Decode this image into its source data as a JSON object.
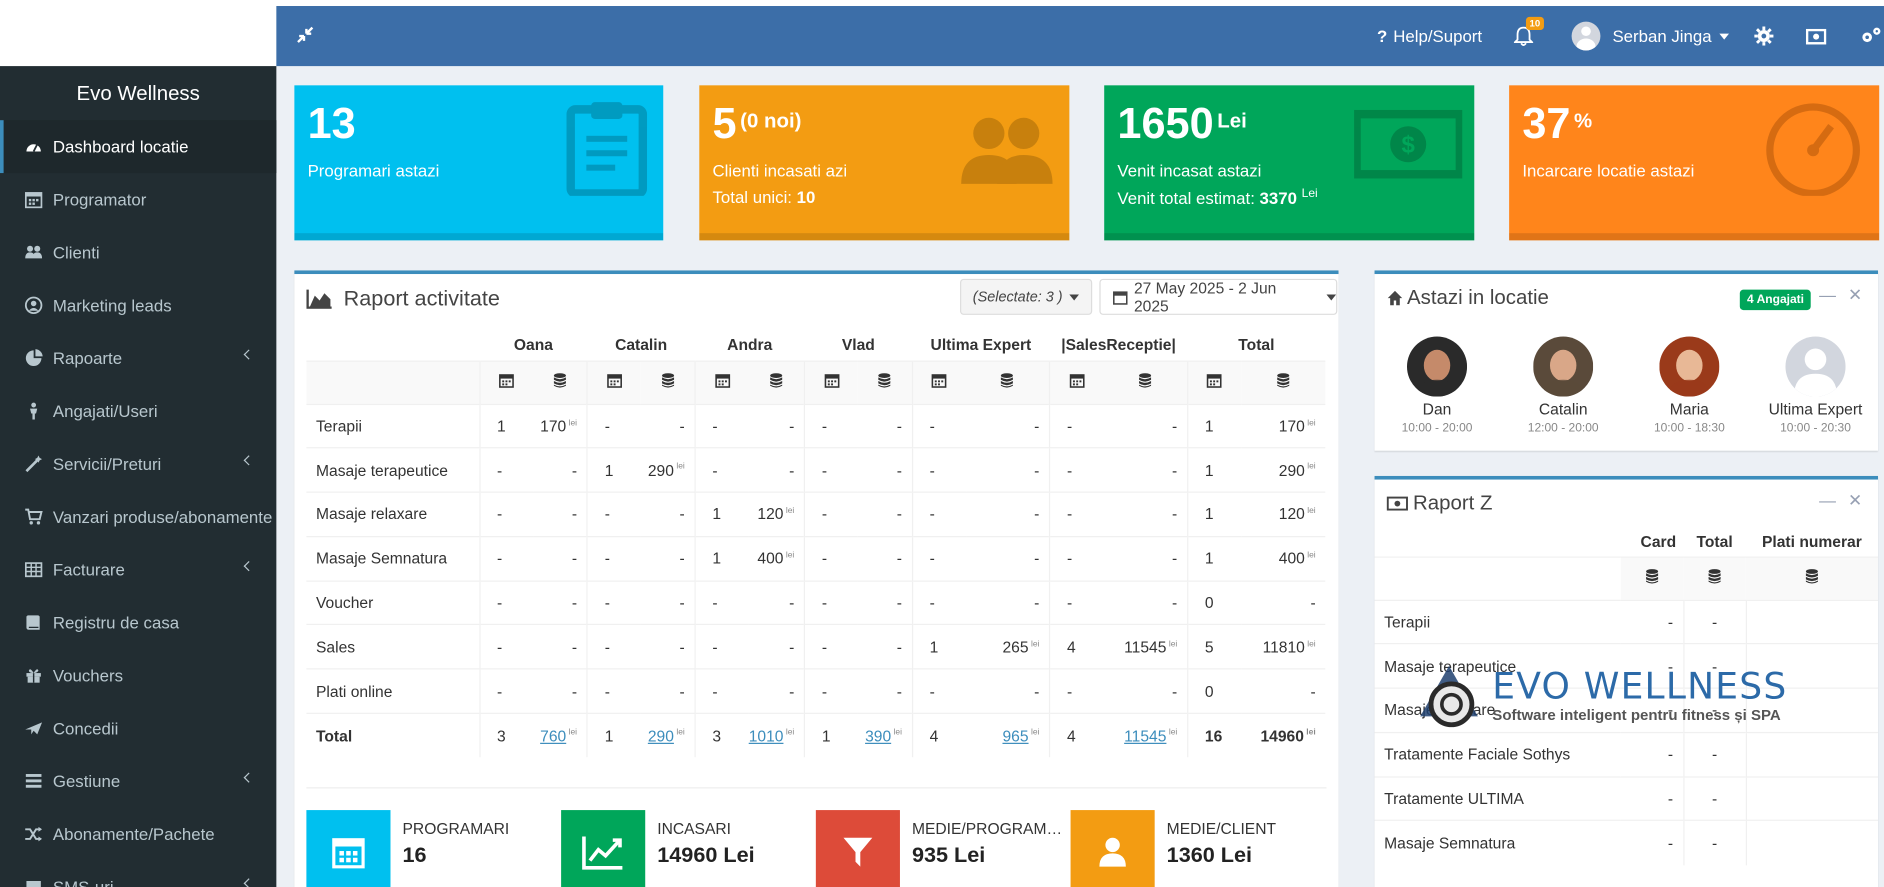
{
  "colors": {
    "navbar": "#3c6ea8",
    "sidebar": "#222d32",
    "aqua": "#00c0ef",
    "yellow": "#f39c12",
    "green": "#00a65a",
    "orange": "#ff851b",
    "red": "#dd4b39",
    "blue": "#3c8dbc"
  },
  "navbar": {
    "help": "Help/Suport",
    "notif_count": "10",
    "user": "Serban Jinga"
  },
  "sidebar": {
    "brand": "Evo Wellness",
    "items": [
      {
        "label": "Dashboard locatie",
        "icon": "dashboard-icon"
      },
      {
        "label": "Programator",
        "icon": "calendar-icon"
      },
      {
        "label": "Clienti",
        "icon": "users-icon"
      },
      {
        "label": "Marketing leads",
        "icon": "user-circle-icon"
      },
      {
        "label": "Rapoarte",
        "icon": "pie-chart-icon"
      },
      {
        "label": "Angajati/Useri",
        "icon": "person-icon"
      },
      {
        "label": "Servicii/Preturi",
        "icon": "magic-icon"
      },
      {
        "label": "Vanzari produse/abonamente",
        "icon": "cart-icon"
      },
      {
        "label": "Facturare",
        "icon": "table-icon"
      },
      {
        "label": "Registru de casa",
        "icon": "book-icon"
      },
      {
        "label": "Vouchers",
        "icon": "gift-icon"
      },
      {
        "label": "Concedii",
        "icon": "plane-icon"
      },
      {
        "label": "Gestiune",
        "icon": "list-icon"
      },
      {
        "label": "Abonamente/Pachete",
        "icon": "random-icon"
      },
      {
        "label": "SMS-uri",
        "icon": "sms-icon"
      }
    ]
  },
  "stats": {
    "appointments": {
      "value": "13",
      "label": "Programari astazi"
    },
    "clients": {
      "value": "5",
      "sup": "(0 noi)",
      "label": "Clienti incasati azi",
      "sub_label": "Total unici:",
      "sub_value": "10"
    },
    "revenue": {
      "value": "1650",
      "sup": "Lei",
      "label": "Venit incasat astazi",
      "sub_label": "Venit total estimat:",
      "sub_value": "3370",
      "sub_unit": "Lei"
    },
    "load": {
      "value": "37",
      "sup": "%",
      "label": "Incarcare locatie astazi"
    }
  },
  "report": {
    "title": "Raport activitate",
    "select_label": "(Selectate: 3 )",
    "date_range": "27 May 2025 - 2 Jun 2025",
    "columns": [
      "Oana",
      "Catalin",
      "Andra",
      "Vlad",
      "Ultima Expert",
      "|SalesReceptie|",
      "Total"
    ],
    "unit": "lei",
    "rows": [
      {
        "label": "Terapii",
        "cells": [
          [
            "1",
            "170"
          ],
          [
            "-",
            "-"
          ],
          [
            "-",
            "-"
          ],
          [
            "-",
            "-"
          ],
          [
            "-",
            "-"
          ],
          [
            "-",
            "-"
          ],
          [
            "1",
            "170"
          ]
        ]
      },
      {
        "label": "Masaje terapeutice",
        "cells": [
          [
            "-",
            "-"
          ],
          [
            "1",
            "290"
          ],
          [
            "-",
            "-"
          ],
          [
            "-",
            "-"
          ],
          [
            "-",
            "-"
          ],
          [
            "-",
            "-"
          ],
          [
            "1",
            "290"
          ]
        ]
      },
      {
        "label": "Masaje relaxare",
        "cells": [
          [
            "-",
            "-"
          ],
          [
            "-",
            "-"
          ],
          [
            "1",
            "120"
          ],
          [
            "-",
            "-"
          ],
          [
            "-",
            "-"
          ],
          [
            "-",
            "-"
          ],
          [
            "1",
            "120"
          ]
        ]
      },
      {
        "label": "Masaje Semnatura",
        "cells": [
          [
            "-",
            "-"
          ],
          [
            "-",
            "-"
          ],
          [
            "1",
            "400"
          ],
          [
            "-",
            "-"
          ],
          [
            "-",
            "-"
          ],
          [
            "-",
            "-"
          ],
          [
            "1",
            "400"
          ]
        ]
      },
      {
        "label": "Voucher",
        "cells": [
          [
            "-",
            "-"
          ],
          [
            "-",
            "-"
          ],
          [
            "-",
            "-"
          ],
          [
            "-",
            "-"
          ],
          [
            "-",
            "-"
          ],
          [
            "-",
            "-"
          ],
          [
            "0",
            "-"
          ]
        ]
      },
      {
        "label": "Sales",
        "cells": [
          [
            "-",
            "-"
          ],
          [
            "-",
            "-"
          ],
          [
            "-",
            "-"
          ],
          [
            "-",
            "-"
          ],
          [
            "1",
            "265"
          ],
          [
            "4",
            "11545"
          ],
          [
            "5",
            "11810"
          ]
        ]
      },
      {
        "label": "Plati online",
        "cells": [
          [
            "-",
            "-"
          ],
          [
            "-",
            "-"
          ],
          [
            "-",
            "-"
          ],
          [
            "-",
            "-"
          ],
          [
            "-",
            "-"
          ],
          [
            "-",
            "-"
          ],
          [
            "0",
            "-"
          ]
        ]
      }
    ],
    "total": {
      "label": "Total",
      "cells": [
        [
          "3",
          "760"
        ],
        [
          "1",
          "290"
        ],
        [
          "3",
          "1010"
        ],
        [
          "1",
          "390"
        ],
        [
          "4",
          "965"
        ],
        [
          "4",
          "11545"
        ],
        [
          "16",
          "14960"
        ]
      ]
    }
  },
  "kpis": [
    {
      "title": "PROGRAMARI",
      "value": "16",
      "color": "#00c0ef",
      "icon": "calendar-icon"
    },
    {
      "title": "INCASARI",
      "value": "14960 Lei",
      "color": "#00a65a",
      "icon": "line-chart-icon"
    },
    {
      "title": "MEDIE/PROGRAMARE",
      "value": "935 Lei",
      "color": "#dd4b39",
      "icon": "filter-icon"
    },
    {
      "title": "MEDIE/CLIENT",
      "value": "1360 Lei",
      "color": "#f39c12",
      "icon": "user-icon"
    }
  ],
  "today": {
    "title": "Astazi in locatie",
    "badge": "4 Angajati",
    "employees": [
      {
        "name": "Dan",
        "hours": "10:00 - 20:00"
      },
      {
        "name": "Catalin",
        "hours": "12:00 - 20:00"
      },
      {
        "name": "Maria",
        "hours": "10:00 - 18:30"
      },
      {
        "name": "Ultima Expert",
        "hours": "10:00 - 20:30"
      }
    ]
  },
  "raportz": {
    "title": "Raport Z",
    "columns": [
      "Card",
      "Total",
      "Plati numerar"
    ],
    "rows": [
      {
        "label": "Terapii",
        "card": "-",
        "total": "-"
      },
      {
        "label": "Masaje terapeutice",
        "card": "-",
        "total": "-"
      },
      {
        "label": "Masaje relaxare",
        "card": "-",
        "total": "-"
      },
      {
        "label": "Tratamente Faciale Sothys",
        "card": "-",
        "total": "-"
      },
      {
        "label": "Tratamente ULTIMA",
        "card": "-",
        "total": "-"
      },
      {
        "label": "Masaje Semnatura",
        "card": "-",
        "total": "-"
      }
    ]
  },
  "watermark": {
    "name": "EVO WELLNESS",
    "tagline": "Software inteligent pentru fitness și SPA"
  }
}
